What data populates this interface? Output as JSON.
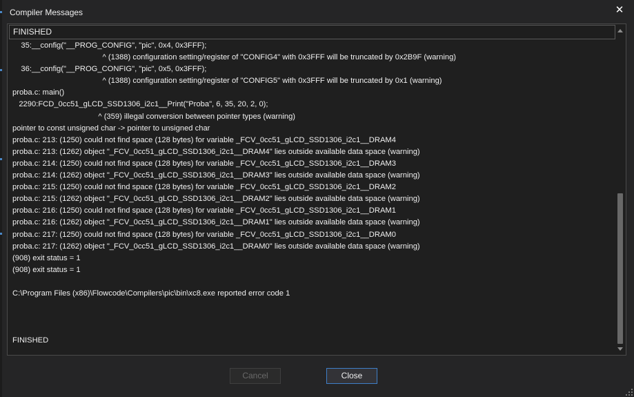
{
  "window": {
    "title": "Compiler Messages",
    "close_glyph": "✕"
  },
  "output": {
    "status_top": "FINISHED",
    "lines": [
      "    35:__config(\"__PROG_CONFIG\", \"pic\", 0x4, 0x3FFF);",
      "                                          ^ (1388) configuration setting/register of \"CONFIG4\" with 0x3FFF will be truncated by 0x2B9F (warning)",
      "    36:__config(\"__PROG_CONFIG\", \"pic\", 0x5, 0x3FFF);",
      "                                          ^ (1388) configuration setting/register of \"CONFIG5\" with 0x3FFF will be truncated by 0x1 (warning)",
      "proba.c: main()",
      "   2290:FCD_0cc51_gLCD_SSD1306_i2c1__Print(\"Proba\", 6, 35, 20, 2, 0);",
      "                                        ^ (359) illegal conversion between pointer types (warning)",
      "pointer to const unsigned char -> pointer to unsigned char",
      "proba.c: 213: (1250) could not find space (128 bytes) for variable _FCV_0cc51_gLCD_SSD1306_i2c1__DRAM4",
      "proba.c: 213: (1262) object \"_FCV_0cc51_gLCD_SSD1306_i2c1__DRAM4\" lies outside available data space (warning)",
      "proba.c: 214: (1250) could not find space (128 bytes) for variable _FCV_0cc51_gLCD_SSD1306_i2c1__DRAM3",
      "proba.c: 214: (1262) object \"_FCV_0cc51_gLCD_SSD1306_i2c1__DRAM3\" lies outside available data space (warning)",
      "proba.c: 215: (1250) could not find space (128 bytes) for variable _FCV_0cc51_gLCD_SSD1306_i2c1__DRAM2",
      "proba.c: 215: (1262) object \"_FCV_0cc51_gLCD_SSD1306_i2c1__DRAM2\" lies outside available data space (warning)",
      "proba.c: 216: (1250) could not find space (128 bytes) for variable _FCV_0cc51_gLCD_SSD1306_i2c1__DRAM1",
      "proba.c: 216: (1262) object \"_FCV_0cc51_gLCD_SSD1306_i2c1__DRAM1\" lies outside available data space (warning)",
      "proba.c: 217: (1250) could not find space (128 bytes) for variable _FCV_0cc51_gLCD_SSD1306_i2c1__DRAM0",
      "proba.c: 217: (1262) object \"_FCV_0cc51_gLCD_SSD1306_i2c1__DRAM0\" lies outside available data space (warning)",
      "(908) exit status = 1",
      "(908) exit status = 1",
      "",
      "C:\\Program Files (x86)\\Flowcode\\Compilers\\pic\\bin\\xc8.exe reported error code 1",
      "",
      "",
      "",
      "FINISHED"
    ]
  },
  "buttons": {
    "cancel_label": "Cancel",
    "close_label": "Close"
  },
  "colors": {
    "background": "#252526",
    "text": "#f0f0f0",
    "accent": "#3e7fc8",
    "disabled_text": "#6a6a6a"
  }
}
